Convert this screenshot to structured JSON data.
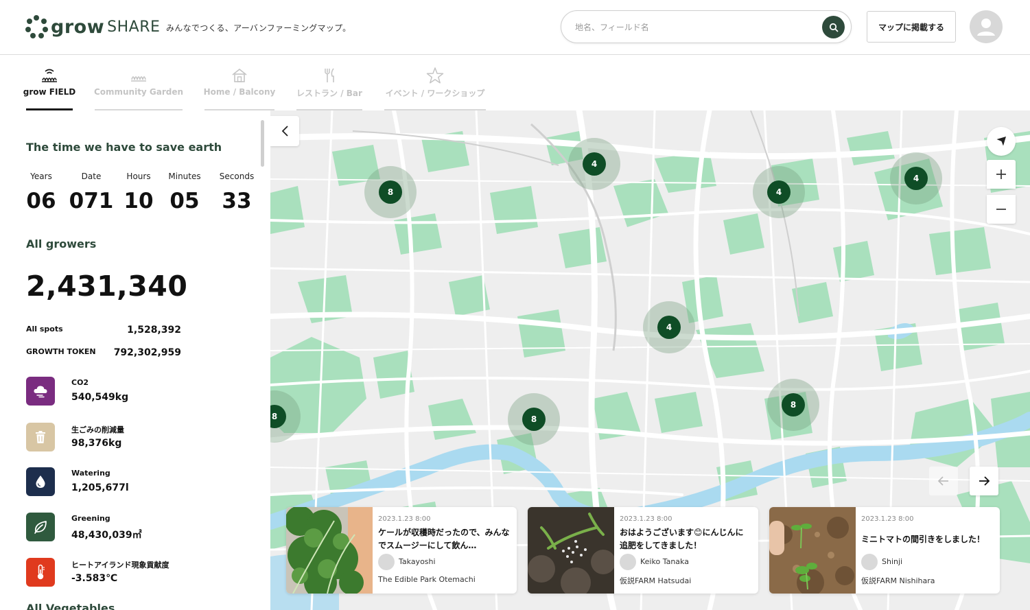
{
  "header": {
    "logo_grow": "grow",
    "logo_share": "SHARE",
    "tagline": "みんなでつくる、アーバンファーミングマップ。",
    "search_placeholder": "地名、フィールド名",
    "post_button": "マップに掲載する"
  },
  "tabs": [
    {
      "label": "grow FIELD",
      "icon": "grow-field-icon",
      "active": true
    },
    {
      "label": "Community Garden",
      "icon": "community-garden-icon",
      "active": false
    },
    {
      "label": "Home / Balcony",
      "icon": "house-icon",
      "active": false
    },
    {
      "label": "レストラン / Bar",
      "icon": "fork-knife-icon",
      "active": false
    },
    {
      "label": "イベント / ワークショップ",
      "icon": "star-icon",
      "active": false
    }
  ],
  "sidebar": {
    "title": "The time we have to save earth",
    "countdown": {
      "labels": [
        "Years",
        "Date",
        "Hours",
        "Minutes",
        "Seconds"
      ],
      "values": [
        "06",
        "071",
        "10",
        "05",
        "33"
      ]
    },
    "growers_title": "All growers",
    "growers_count": "2,431,340",
    "stats": [
      {
        "label": "All spots",
        "value": "1,528,392"
      },
      {
        "label": "GROWTH TOKEN",
        "value": "792,302,959"
      }
    ],
    "metrics": [
      {
        "label": "CO2",
        "value": "540,549kg",
        "icon": "cloud-icon",
        "color": "#7a2c80"
      },
      {
        "label": "生ごみの削減量",
        "value": "98,376kg",
        "icon": "trash-icon",
        "color": "#d8c6a4"
      },
      {
        "label": "Watering",
        "value": "1,205,677l",
        "icon": "water-drop-icon",
        "color": "#1d2e4d"
      },
      {
        "label": "Greening",
        "value": "48,430,039㎡",
        "icon": "leaf-icon",
        "color": "#2f5a3e"
      },
      {
        "label": "ヒートアイランド現象貢献度",
        "value": "-3.583℃",
        "icon": "thermometer-icon",
        "color": "#e03a1e"
      }
    ],
    "vegetables_title": "All Vegetables"
  },
  "map": {
    "clusters": [
      "8",
      "4",
      "4",
      "4",
      "4",
      "8",
      "8",
      "8"
    ],
    "colors": {
      "park": "#a9e0bd",
      "water": "#aadaf0",
      "road": "#ffffff",
      "land": "#eeeeee",
      "cluster_dot": "#0f4d26"
    }
  },
  "cards": [
    {
      "date": "2023.1.23 8:00",
      "text": "ケールが収穫時だったので、みんなでスムージーにして飲ん…",
      "user": "Takayoshi",
      "location": "The Edible Park Otemachi"
    },
    {
      "date": "2023.1.23 8:00",
      "text": "おはようございます😊にんじんに追肥をしてきました！",
      "user": "Keiko Tanaka",
      "location": "仮説FARM Hatsudai"
    },
    {
      "date": "2023.1.23 8:00",
      "text": "ミニトマトの間引きをしました！",
      "user": "Shinji",
      "location": "仮説FARM Nishihara"
    }
  ]
}
